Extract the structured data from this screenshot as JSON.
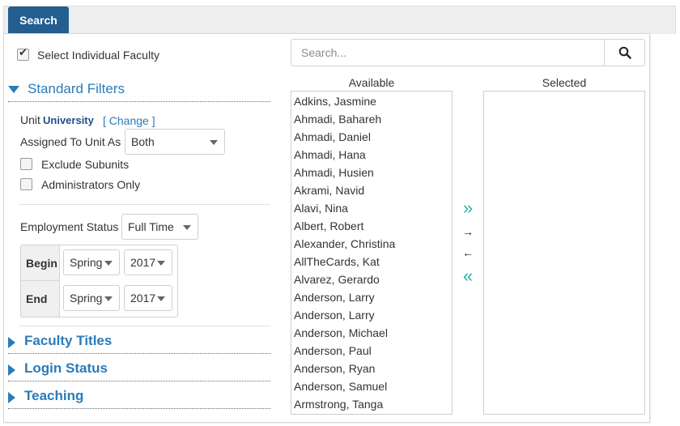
{
  "tabs": {
    "search_label": "Search"
  },
  "select_individual": {
    "label": "Select Individual Faculty",
    "checked": true
  },
  "standard_filters": {
    "title": "Standard Filters",
    "unit_label": "Unit",
    "unit_value": "University",
    "change_link": "[ Change ]",
    "assigned_label": "Assigned To Unit As",
    "assigned_value": "Both",
    "exclude_subunits": "Exclude Subunits",
    "administrators_only": "Administrators Only",
    "employment_label": "Employment Status",
    "employment_value": "Full Time",
    "begin_label": "Begin",
    "begin_term": "Spring",
    "begin_year": "2017",
    "end_label": "End",
    "end_term": "Spring",
    "end_year": "2017"
  },
  "sections": {
    "faculty_titles": "Faculty Titles",
    "login_status": "Login Status",
    "teaching": "Teaching"
  },
  "search": {
    "placeholder": "Search..."
  },
  "available": {
    "heading": "Available",
    "items": [
      "Adkins, Jasmine",
      "Ahmadi, Bahareh",
      "Ahmadi, Daniel",
      "Ahmadi, Hana",
      "Ahmadi, Husien",
      "Akrami, Navid",
      "Alavi, Nina",
      "Albert, Robert",
      "Alexander, Christina",
      "AllTheCards, Kat",
      "Alvarez, Gerardo",
      "Anderson, Larry",
      "Anderson, Larry",
      "Anderson, Michael",
      "Anderson, Paul",
      "Anderson, Ryan",
      "Anderson, Samuel",
      "Armstrong, Tanga"
    ]
  },
  "selected": {
    "heading": "Selected"
  },
  "move_buttons": {
    "add_all": "»",
    "add_one": "→",
    "remove_one": "←",
    "remove_all": "«"
  },
  "colors": {
    "accent": "#2b7bb9",
    "tab": "#245d8f",
    "move_all": "#2ab3a6"
  },
  "icons": {
    "search": "magnifier-icon",
    "check": "check-icon"
  }
}
